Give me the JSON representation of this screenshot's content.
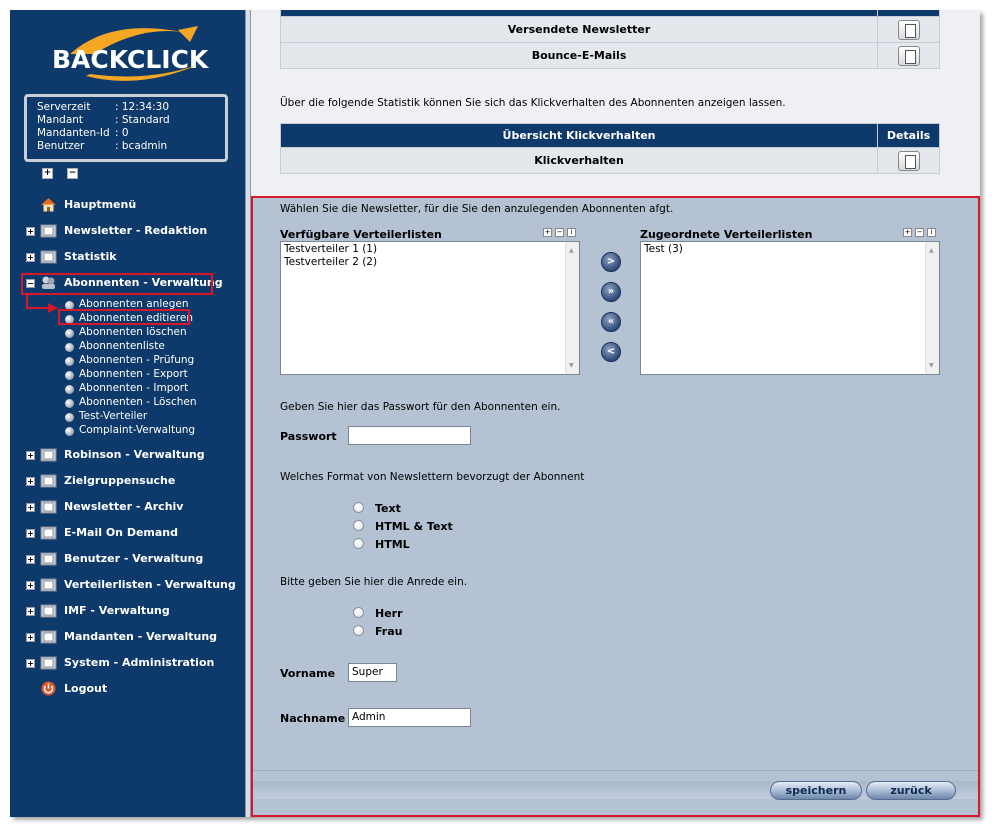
{
  "brand": {
    "logo_text": "BACKCLICK",
    "accent": "#f5a623",
    "nav_bg": "#0e3a6b"
  },
  "info": [
    {
      "key": "Serverzeit",
      "value": ": 12:34:30"
    },
    {
      "key": "Mandant",
      "value": ": Standard"
    },
    {
      "key": "Mandanten-Id",
      "value": ": 0"
    },
    {
      "key": "Benutzer",
      "value": ": bcadmin"
    }
  ],
  "nav": {
    "hauptmenu": "Hauptmenü",
    "items_top": [
      {
        "label": "Newsletter - Redaktion",
        "icon": "folder-icon"
      },
      {
        "label": "Statistik",
        "icon": "folder-icon"
      },
      {
        "label": "Abonnenten - Verwaltung",
        "icon": "users-icon"
      }
    ],
    "sub_items": [
      "Abonnenten anlegen",
      "Abonnenten editieren",
      "Abonnenten löschen",
      "Abonnentenliste",
      "Abonnenten - Prüfung",
      "Abonnenten - Export",
      "Abonnenten - Import",
      "Abonnenten - Löschen",
      "Test-Verteiler",
      "Complaint-Verwaltung"
    ],
    "items_bottom": [
      "Robinson - Verwaltung",
      "Zielgruppensuche",
      "Newsletter - Archiv",
      "E-Mail On Demand",
      "Benutzer - Verwaltung",
      "Verteilerlisten - Verwaltung",
      "IMF - Verwaltung",
      "Mandanten - Verwaltung",
      "System - Administration"
    ],
    "logout": "Logout"
  },
  "stats": {
    "rows_top": [
      "Versendete Newsletter",
      "Bounce-E-Mails"
    ],
    "intro": "Über die folgende Statistik können Sie sich das Klickverhalten des Abonnenten anzeigen lassen.",
    "klick_header": "Übersicht Klickverhalten",
    "details_header": "Details",
    "klick_row": "Klickverhalten"
  },
  "form": {
    "newsletter_prompt": "Wählen Sie die Newsletter, für die Sie den anzulegenden Abonnenten afgt.",
    "available_label": "Verfügbare Verteilerlisten",
    "assigned_label": "Zugeordnete Verteilerlisten",
    "available": [
      "Testverteiler 1 (1)",
      "Testverteiler 2 (2)"
    ],
    "assigned": [
      "Test (3)"
    ],
    "move_buttons": [
      ">",
      "»",
      "«",
      "<"
    ],
    "password_prompt": "Geben Sie hier das Passwort für den Abonnenten ein.",
    "password_label": "Passwort",
    "password_value": "",
    "format_prompt": "Welches Format von Newslettern bevorzugt der Abonnent",
    "formats": [
      "Text",
      "HTML & Text",
      "HTML"
    ],
    "salutation_prompt": "Bitte geben Sie hier die Anrede ein.",
    "salutations": [
      "Herr",
      "Frau"
    ],
    "firstname_label": "Vorname",
    "firstname_value": "Super",
    "lastname_label": "Nachname",
    "lastname_value": "Admin",
    "save_label": "speichern",
    "back_label": "zurück"
  }
}
